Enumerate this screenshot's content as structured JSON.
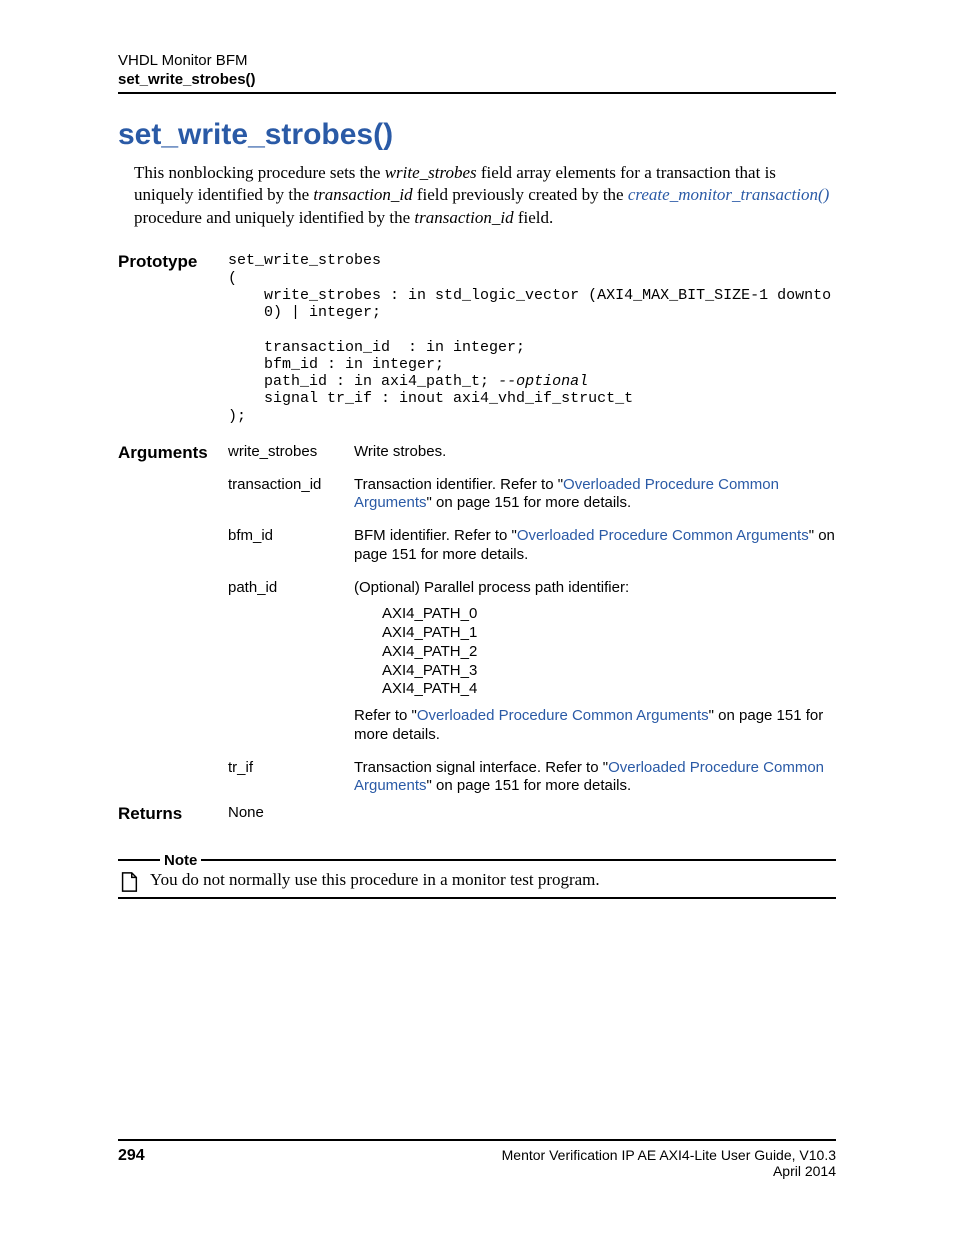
{
  "header": {
    "line1": "VHDL Monitor BFM",
    "line2": "set_write_strobes()"
  },
  "title": "set_write_strobes()",
  "intro": {
    "t1": "This nonblocking procedure sets the ",
    "i1": "write_strobes",
    "t2": " field array elements for a transaction that is uniquely identified by the ",
    "i2": "transaction_id",
    "t3": " field previously created by the ",
    "link": "create_monitor_transaction()",
    "t4": " procedure and uniquely identified by the ",
    "i3": "transaction_id",
    "t5": " field."
  },
  "labels": {
    "prototype": "Prototype",
    "arguments": "Arguments",
    "returns": "Returns",
    "note": "Note"
  },
  "prototype": {
    "l1": "set_write_strobes",
    "l2": "(",
    "l3": "    write_strobes : in std_logic_vector (AXI4_MAX_BIT_SIZE-1 downto",
    "l4": "    0) | integer;",
    "blank": "",
    "l5": "    transaction_id  : in integer;",
    "l6": "    bfm_id : in integer;",
    "l7a": "    path_id : in axi4_path_t; ",
    "l7b": "--optional",
    "l8": "    signal tr_if : inout axi4_vhd_if_struct_t",
    "l9": ");"
  },
  "args": {
    "write_strobes": {
      "name": "write_strobes",
      "desc": "Write strobes."
    },
    "transaction_id": {
      "name": "transaction_id",
      "pre": "Transaction identifier. Refer to \"",
      "link": "Overloaded Procedure Common Arguments",
      "post": "\" on page 151 for more details."
    },
    "bfm_id": {
      "name": "bfm_id",
      "pre": "BFM identifier. Refer to \"",
      "link": "Overloaded Procedure Common Arguments",
      "post": "\" on page 151 for more details."
    },
    "path_id": {
      "name": "path_id",
      "desc": "(Optional) Parallel process path identifier:",
      "paths": [
        "AXI4_PATH_0",
        "AXI4_PATH_1",
        "AXI4_PATH_2",
        "AXI4_PATH_3",
        "AXI4_PATH_4"
      ],
      "pre2": "Refer to \"",
      "link": "Overloaded Procedure Common Arguments",
      "post2": "\" on page 151 for more details."
    },
    "tr_if": {
      "name": "tr_if",
      "pre": "Transaction signal interface. Refer to \"",
      "link": "Overloaded Procedure Common Arguments",
      "post": "\" on page 151 for more details."
    }
  },
  "returns": "None",
  "note_text": "You do not normally use this procedure in a monitor test program.",
  "footer": {
    "page": "294",
    "guide": "Mentor Verification IP AE AXI4-Lite User Guide, V10.3",
    "date": "April 2014"
  }
}
